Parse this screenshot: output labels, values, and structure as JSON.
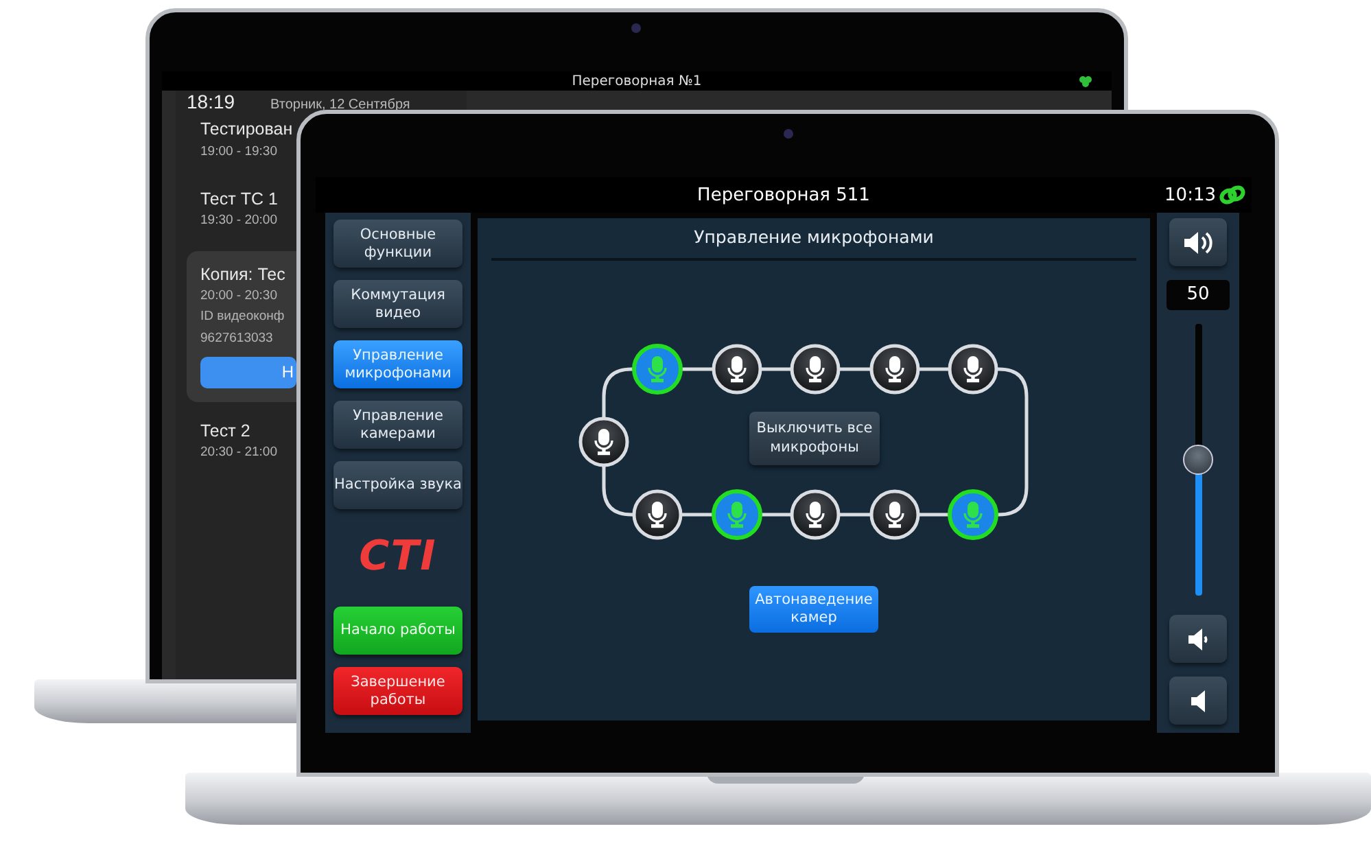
{
  "back_laptop": {
    "title": "Переговорная №1",
    "time": "18:19",
    "date": "Вторник, 12 Сентября",
    "events": [
      {
        "title": "Тестирован",
        "time": "19:00 - 19:30",
        "selected": false
      },
      {
        "title": "Тест ТС 1",
        "time": "19:30 - 20:00",
        "selected": false
      },
      {
        "title": "Копия: Тес",
        "time": "20:00 - 20:30",
        "details": [
          "ID видеоконф",
          "9627613033"
        ],
        "button": "Н",
        "selected": true
      },
      {
        "title": "Тест 2",
        "time": "20:30 - 21:00",
        "selected": false
      }
    ]
  },
  "front_laptop": {
    "title": "Переговорная 511",
    "time": "10:13",
    "menu": [
      {
        "label": "Основные функции",
        "selected": false
      },
      {
        "label": "Коммутация видео",
        "selected": false
      },
      {
        "label": "Управление микрофонами",
        "selected": true
      },
      {
        "label": "Управление камерами",
        "selected": false
      },
      {
        "label": "Настройка звука",
        "selected": false
      }
    ],
    "logo": "CTI",
    "actions": [
      {
        "label": "Начало работы",
        "kind": "start"
      },
      {
        "label": "Завершение работы",
        "kind": "stop"
      }
    ],
    "panel": {
      "title": "Управление микрофонами",
      "microphones": [
        {
          "on": true
        },
        {
          "on": false
        },
        {
          "on": false
        },
        {
          "on": false
        },
        {
          "on": false
        },
        {
          "on": false
        },
        {
          "on": false
        },
        {
          "on": true
        },
        {
          "on": false
        },
        {
          "on": false
        },
        {
          "on": true
        }
      ],
      "mute_all_button": "Выключить все микрофоны",
      "auto_button": "Автонаведение камер"
    },
    "volume": {
      "reading": "50",
      "level": 0.5
    }
  }
}
